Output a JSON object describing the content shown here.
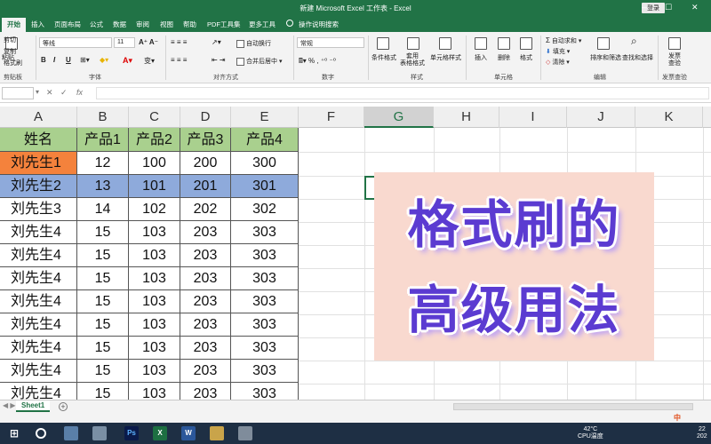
{
  "window": {
    "title": "新建 Microsoft Excel 工作表 - Excel",
    "login_label": "登录",
    "accent": "#217346"
  },
  "ribbon_tabs": [
    "开始",
    "插入",
    "页面布局",
    "公式",
    "数据",
    "审阅",
    "视图",
    "帮助",
    "PDF工具集",
    "更多工具",
    "操作说明搜索"
  ],
  "ribbon": {
    "clipboard": {
      "cut": "剪切",
      "copy": "复制",
      "painter": "格式刷",
      "group": "剪贴板"
    },
    "font": {
      "name": "等线",
      "size": "11",
      "bold": "B",
      "italic": "I",
      "underline": "U",
      "group": "字体"
    },
    "align": {
      "wrap": "自动换行",
      "merge": "合并后居中",
      "group": "对齐方式"
    },
    "number": {
      "format": "常规",
      "group": "数字"
    },
    "styles": {
      "conditional": "条件格式",
      "table": "套用\n表格格式",
      "cell": "单元格样式",
      "group": "样式"
    },
    "cells": {
      "insert": "插入",
      "delete": "删除",
      "format": "格式",
      "group": "单元格"
    },
    "editing": {
      "autosum": "自动求和",
      "fill": "填充",
      "clear": "清除",
      "sort": "排序和筛选",
      "find": "查找和选择",
      "group": "编辑"
    },
    "check": {
      "label": "发票\n查验",
      "group": "发票查验"
    }
  },
  "formula_bar": {
    "fx": "fx",
    "value": ""
  },
  "columns": [
    "A",
    "B",
    "C",
    "D",
    "E",
    "F",
    "G",
    "H",
    "I",
    "J",
    "K"
  ],
  "selected_column": "G",
  "table": {
    "header": [
      "姓名",
      "产品1",
      "产品2",
      "产品3",
      "产品4"
    ],
    "rows": [
      [
        "刘先生1",
        "12",
        "100",
        "200",
        "300"
      ],
      [
        "刘先生2",
        "13",
        "101",
        "201",
        "301"
      ],
      [
        "刘先生3",
        "14",
        "102",
        "202",
        "302"
      ],
      [
        "刘先生4",
        "15",
        "103",
        "203",
        "303"
      ],
      [
        "刘先生4",
        "15",
        "103",
        "203",
        "303"
      ],
      [
        "刘先生4",
        "15",
        "103",
        "203",
        "303"
      ],
      [
        "刘先生4",
        "15",
        "103",
        "203",
        "303"
      ],
      [
        "刘先生4",
        "15",
        "103",
        "203",
        "303"
      ],
      [
        "刘先生4",
        "15",
        "103",
        "203",
        "303"
      ],
      [
        "刘先生4",
        "15",
        "103",
        "203",
        "303"
      ],
      [
        "刘先生4",
        "15",
        "103",
        "203",
        "303"
      ]
    ],
    "colors": {
      "header": "#a9d08e",
      "row1_name": "#f4823c",
      "row2": "#8eaadb"
    }
  },
  "banner": {
    "line1": "格式刷的",
    "line2": "高级用法",
    "bg": "#f9d9cf",
    "text_color": "#5b3bd1"
  },
  "sheet": {
    "tab": "Sheet1",
    "add": "+"
  },
  "status": {
    "ime": "中"
  },
  "taskbar": {
    "temp": "42°C",
    "cpu": "CPU温度",
    "time": "22",
    "date": "202"
  }
}
